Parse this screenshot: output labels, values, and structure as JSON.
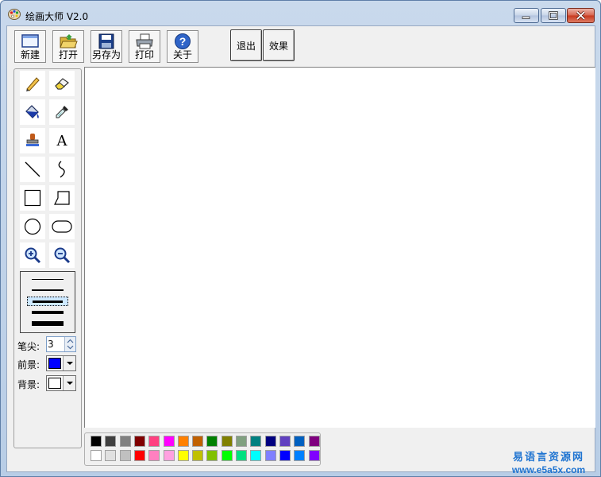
{
  "window": {
    "title": "绘画大师 V2.0",
    "icon": "palette-icon"
  },
  "toolbar": {
    "new_label": "新建",
    "open_label": "打开",
    "saveas_label": "另存为",
    "print_label": "打印",
    "about_label": "关于",
    "exit_label": "退出",
    "effect_label": "效果"
  },
  "tools": [
    {
      "name": "pencil-icon"
    },
    {
      "name": "eraser-icon"
    },
    {
      "name": "fill-bucket-icon"
    },
    {
      "name": "eyedropper-icon"
    },
    {
      "name": "stamp-icon"
    },
    {
      "name": "text-icon"
    },
    {
      "name": "line-icon"
    },
    {
      "name": "curve-icon"
    },
    {
      "name": "rectangle-icon"
    },
    {
      "name": "polygon-icon"
    },
    {
      "name": "ellipse-icon"
    },
    {
      "name": "rounded-rectangle-icon"
    },
    {
      "name": "zoom-in-icon"
    },
    {
      "name": "zoom-out-icon"
    }
  ],
  "text_tool_glyph": "A",
  "line_widths": [
    1,
    2,
    3,
    4,
    6
  ],
  "selected_line_width_index": 2,
  "fields": {
    "pen_tip_label": "笔尖:",
    "pen_tip_value": "3",
    "foreground_label": "前景:",
    "background_label": "背景:"
  },
  "colors": {
    "foreground": "#0000ff",
    "background": "#ffffff",
    "palette_row1": [
      "#000000",
      "#404040",
      "#808080",
      "#800000",
      "#ff4080",
      "#ff00ff",
      "#ff8000",
      "#c06000",
      "#008000",
      "#808000",
      "#80a080",
      "#008080",
      "#000080",
      "#6040c0",
      "#0060c0",
      "#800080"
    ],
    "palette_row2": [
      "#ffffff",
      "#e0e0e0",
      "#c0c0c0",
      "#ff0000",
      "#ff80c0",
      "#ffa0e0",
      "#ffff00",
      "#c0c000",
      "#80c000",
      "#00ff00",
      "#00e080",
      "#00ffff",
      "#8080ff",
      "#0000ff",
      "#0080ff",
      "#8000ff"
    ]
  },
  "watermark": {
    "line1": "易语言资源网",
    "line2": "www.e5a5x.com"
  }
}
